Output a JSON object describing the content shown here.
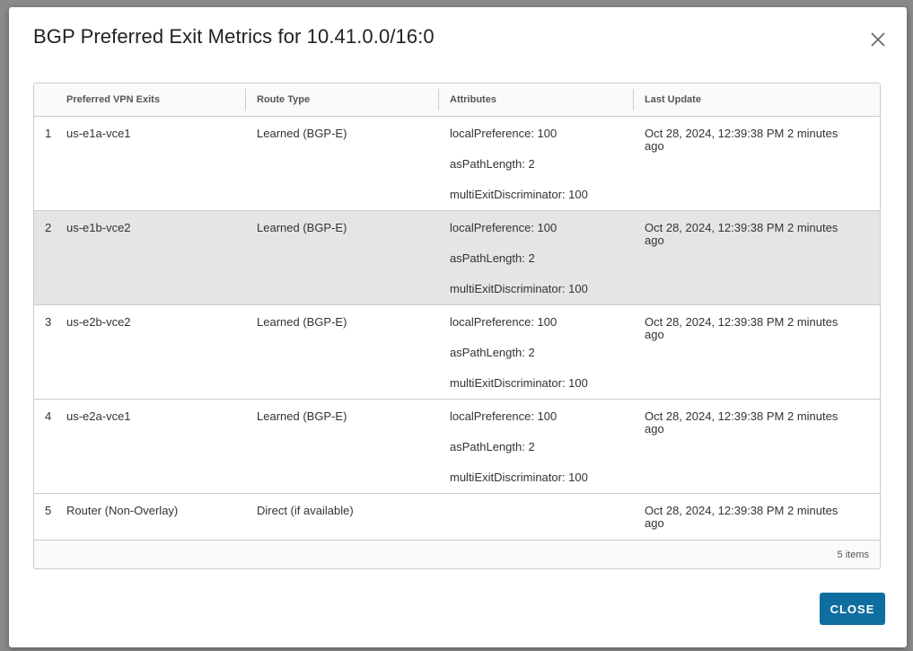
{
  "modal": {
    "title": "BGP Preferred Exit Metrics for 10.41.0.0/16:0",
    "close_button_label": "CLOSE"
  },
  "grid": {
    "columns": [
      "Preferred VPN Exits",
      "Route Type",
      "Attributes",
      "Last Update"
    ],
    "rows": [
      {
        "index": "1",
        "exit": "us-e1a-vce1",
        "route_type": "Learned (BGP-E)",
        "attributes": [
          "localPreference: 100",
          "asPathLength: 2",
          "multiExitDiscriminator: 100"
        ],
        "last_update": "Oct 28, 2024, 12:39:38 PM 2 minutes ago",
        "selected": false
      },
      {
        "index": "2",
        "exit": "us-e1b-vce2",
        "route_type": "Learned (BGP-E)",
        "attributes": [
          "localPreference: 100",
          "asPathLength: 2",
          "multiExitDiscriminator: 100"
        ],
        "last_update": "Oct 28, 2024, 12:39:38 PM 2 minutes ago",
        "selected": true
      },
      {
        "index": "3",
        "exit": "us-e2b-vce2",
        "route_type": "Learned (BGP-E)",
        "attributes": [
          "localPreference: 100",
          "asPathLength: 2",
          "multiExitDiscriminator: 100"
        ],
        "last_update": "Oct 28, 2024, 12:39:38 PM 2 minutes ago",
        "selected": false
      },
      {
        "index": "4",
        "exit": "us-e2a-vce1",
        "route_type": "Learned (BGP-E)",
        "attributes": [
          "localPreference: 100",
          "asPathLength: 2",
          "multiExitDiscriminator: 100"
        ],
        "last_update": "Oct 28, 2024, 12:39:38 PM 2 minutes ago",
        "selected": false
      },
      {
        "index": "5",
        "exit": "Router (Non-Overlay)",
        "route_type": "Direct (if available)",
        "attributes": [],
        "last_update": "Oct 28, 2024, 12:39:38 PM 2 minutes ago",
        "selected": false
      }
    ],
    "footer_count": "5 items"
  },
  "icons": {
    "close": "close-icon"
  },
  "colors": {
    "primary_button": "#0f6ea0",
    "selected_row": "#e5e5e5",
    "backdrop": "#8a8a8a"
  }
}
